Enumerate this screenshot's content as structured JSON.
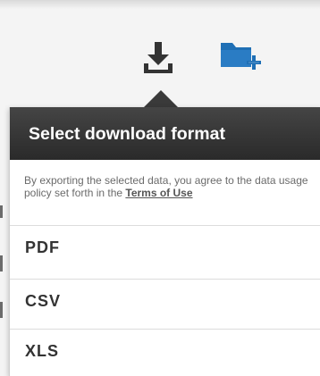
{
  "toolbar": {
    "download_icon": "download-icon",
    "folder_icon": "folder-add-icon",
    "download_color": "#333333",
    "folder_color": "#1f6fb5"
  },
  "popover": {
    "title": "Select download format",
    "notice_text": "By exporting the selected data, you agree to the data usage policy set forth in the ",
    "terms_label": "Terms of Use",
    "formats": [
      {
        "label": "PDF"
      },
      {
        "label": "CSV"
      },
      {
        "label": "XLS"
      }
    ]
  }
}
